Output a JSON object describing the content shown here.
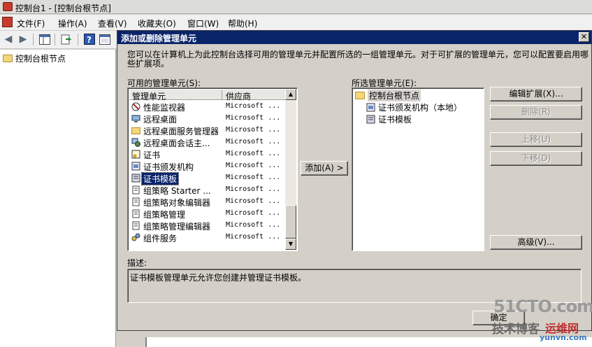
{
  "window": {
    "title": "控制台1 - [控制台根节点]"
  },
  "menu": [
    "文件(F)",
    "操作(A)",
    "查看(V)",
    "收藏夹(O)",
    "窗口(W)",
    "帮助(H)"
  ],
  "tree": {
    "root": "控制台根节点"
  },
  "dialog": {
    "title": "添加或删除管理单元",
    "close_label": "✕",
    "description": "您可以在计算机上为此控制台选择可用的管理单元并配置所选的一组管理单元。对于可扩展的管理单元，您可以配置要启用哪些扩展项。",
    "available_label": "可用的管理单元(S):",
    "selected_label": "所选管理单元(E):",
    "columns": {
      "snapin": "管理单元",
      "vendor": "供应商"
    },
    "available": [
      {
        "name": "性能监视器",
        "vendor": "Microsoft ...",
        "icon": "performance-monitor-icon"
      },
      {
        "name": "远程桌面",
        "vendor": "Microsoft ...",
        "icon": "remote-desktop-icon"
      },
      {
        "name": "远程桌面服务管理器",
        "vendor": "Microsoft ...",
        "icon": "folder-icon"
      },
      {
        "name": "远程桌面会话主...",
        "vendor": "Microsoft ...",
        "icon": "session-host-icon"
      },
      {
        "name": "证书",
        "vendor": "Microsoft ...",
        "icon": "certificate-icon"
      },
      {
        "name": "证书颁发机构",
        "vendor": "Microsoft ...",
        "icon": "ca-icon"
      },
      {
        "name": "证书模板",
        "vendor": "Microsoft ...",
        "icon": "template-icon",
        "selected": true
      },
      {
        "name": "组策略 Starter ...",
        "vendor": "Microsoft ...",
        "icon": "policy-icon"
      },
      {
        "name": "组策略对象编辑器",
        "vendor": "Microsoft ...",
        "icon": "policy-icon"
      },
      {
        "name": "组策略管理",
        "vendor": "Microsoft ...",
        "icon": "policy-icon"
      },
      {
        "name": "组策略管理编辑器",
        "vendor": "Microsoft ...",
        "icon": "policy-icon"
      },
      {
        "name": "组件服务",
        "vendor": "Microsoft ...",
        "icon": "component-services-icon"
      }
    ],
    "add_button": "添加(A) >",
    "selected": {
      "root": "控制台根节点",
      "children": [
        "证书颁发机构（本地）",
        "证书模板"
      ]
    },
    "buttons": {
      "edit_extensions": "编辑扩展(X)...",
      "remove": "删除(R)",
      "move_up": "上移(U)",
      "move_down": "下移(D)",
      "advanced": "高级(V)..."
    },
    "desc_label": "描述:",
    "desc_text": "证书模板管理单元允许您创建并管理证书模板。",
    "ok_button": "确定"
  },
  "watermark": {
    "line1": "51CTO.com",
    "line2": "技术博客",
    "line3": "运维网",
    "line4": "yunvn.com"
  }
}
